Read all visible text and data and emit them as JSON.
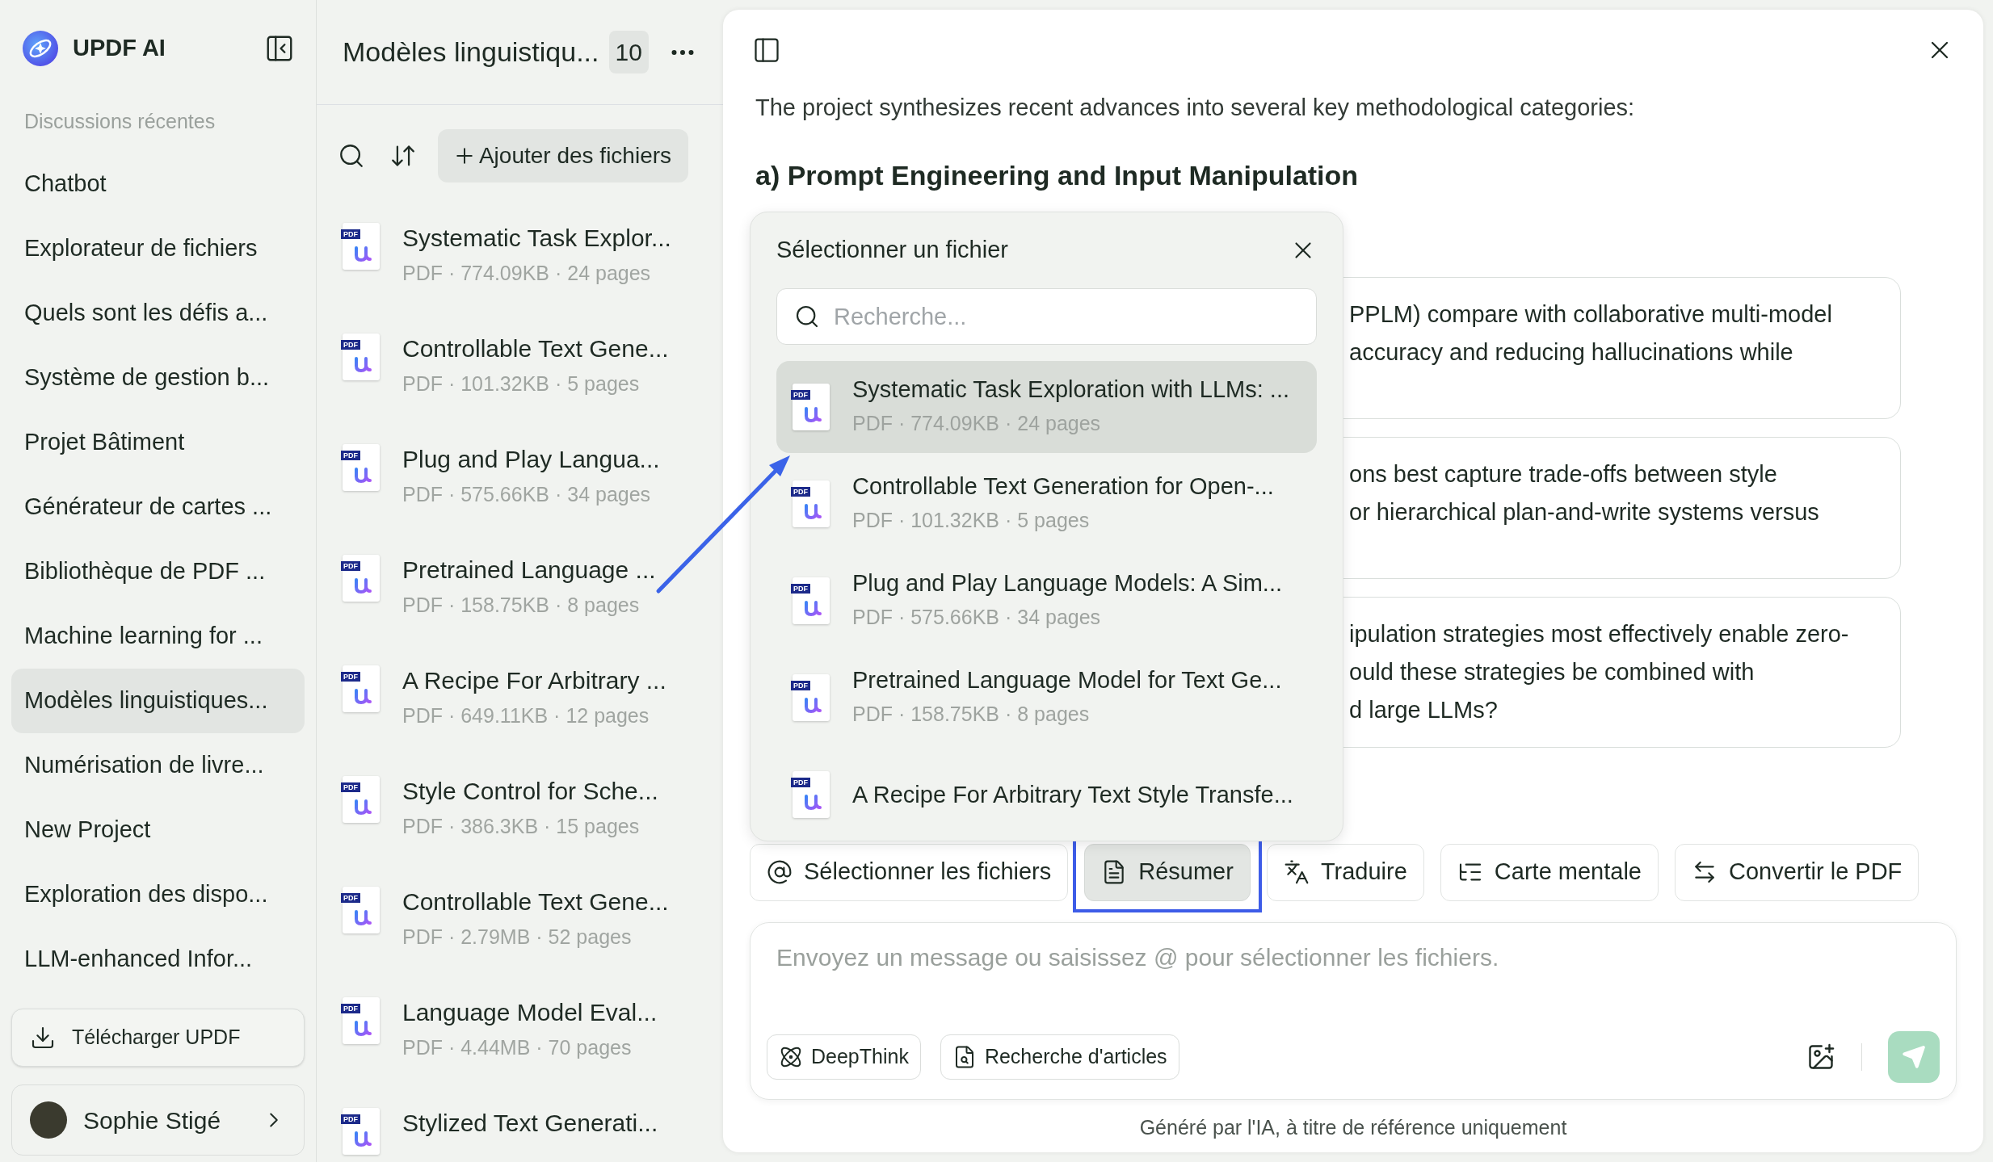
{
  "app": {
    "name": "UPDF AI"
  },
  "sidebar": {
    "section_label": "Discussions récentes",
    "items": [
      {
        "label": "Chatbot",
        "selected": false
      },
      {
        "label": "Explorateur de fichiers",
        "selected": false
      },
      {
        "label": "Quels sont les défis a...",
        "selected": false
      },
      {
        "label": "Système de gestion b...",
        "selected": false
      },
      {
        "label": "Projet Bâtiment",
        "selected": false
      },
      {
        "label": "Générateur de cartes ...",
        "selected": false
      },
      {
        "label": "Bibliothèque de PDF ...",
        "selected": false
      },
      {
        "label": "Machine learning for ...",
        "selected": false
      },
      {
        "label": "Modèles linguistiques...",
        "selected": true
      },
      {
        "label": "Numérisation de livre...",
        "selected": false
      },
      {
        "label": "New Project",
        "selected": false
      },
      {
        "label": "Exploration des dispo...",
        "selected": false
      },
      {
        "label": "LLM-enhanced Infor...",
        "selected": false
      }
    ],
    "download_button": "Télécharger UPDF",
    "user": {
      "name": "Sophie Stigé"
    }
  },
  "project": {
    "title": "Modèles linguistiqu...",
    "count": "10",
    "add_button": "Ajouter des fichiers",
    "files": [
      {
        "icon_label": "PDF",
        "title": "Systematic Task Explor...",
        "meta": "PDF · 774.09KB · 24 pages"
      },
      {
        "icon_label": "PDF",
        "title": "Controllable Text Gene...",
        "meta": "PDF · 101.32KB · 5 pages"
      },
      {
        "icon_label": "PDF",
        "title": "Plug and Play Langua...",
        "meta": "PDF · 575.66KB · 34 pages"
      },
      {
        "icon_label": "PDF",
        "title": "Pretrained Language ...",
        "meta": "PDF · 158.75KB · 8 pages"
      },
      {
        "icon_label": "PDF",
        "title": "A Recipe For Arbitrary ...",
        "meta": "PDF · 649.11KB · 12 pages"
      },
      {
        "icon_label": "PDF",
        "title": "Style Control for Sche...",
        "meta": "PDF · 386.3KB · 15 pages"
      },
      {
        "icon_label": "PDF",
        "title": "Controllable Text Gene...",
        "meta": "PDF · 2.79MB · 52 pages"
      },
      {
        "icon_label": "PDF",
        "title": "Language Model Eval...",
        "meta": "PDF · 4.44MB · 70 pages"
      },
      {
        "icon_label": "PDF",
        "title": "Stylized Text Generati..."
      }
    ]
  },
  "chat": {
    "intro": "The project synthesizes recent advances into several key methodological categories:",
    "heading": "a) Prompt Engineering and Input Manipulation",
    "cards": [
      {
        "lines": [
          "PPLM) compare with collaborative multi-model",
          "accuracy and reducing hallucinations while"
        ]
      },
      {
        "lines": [
          "ons best capture trade-offs between style",
          "or hierarchical plan-and-write systems versus"
        ]
      },
      {
        "lines": [
          "ipulation strategies most effectively enable zero-",
          "ould these strategies be combined with",
          "d large LLMs?"
        ]
      }
    ]
  },
  "file_picker": {
    "title": "Sélectionner un fichier",
    "search_placeholder": "Recherche...",
    "files": [
      {
        "icon_label": "PDF",
        "title": "Systematic Task Exploration with LLMs: ...",
        "meta": "PDF · 774.09KB · 24 pages",
        "selected": true
      },
      {
        "icon_label": "PDF",
        "title": "Controllable Text Generation for Open-...",
        "meta": "PDF · 101.32KB · 5 pages",
        "selected": false
      },
      {
        "icon_label": "PDF",
        "title": "Plug and Play Language Models: A Sim...",
        "meta": "PDF · 575.66KB · 34 pages",
        "selected": false
      },
      {
        "icon_label": "PDF",
        "title": "Pretrained Language Model for Text Ge...",
        "meta": "PDF · 158.75KB · 8 pages",
        "selected": false
      },
      {
        "icon_label": "PDF",
        "title": "A Recipe For Arbitrary Text Style Transfe...",
        "selected": false
      }
    ]
  },
  "actions": [
    {
      "kind": "mention",
      "label": "Sélectionner les fichiers",
      "selected": false
    },
    {
      "kind": "summarize",
      "label": "Résumer",
      "selected": true
    },
    {
      "kind": "translate",
      "label": "Traduire",
      "selected": false
    },
    {
      "kind": "mindmap",
      "label": "Carte mentale",
      "selected": false
    },
    {
      "kind": "convert",
      "label": "Convertir le PDF",
      "selected": false
    }
  ],
  "composer": {
    "placeholder": "Envoyez un message ou saisissez @ pour sélectionner les fichiers.",
    "tools": [
      {
        "kind": "deepthink",
        "label": "DeepThink"
      },
      {
        "kind": "research",
        "label": "Recherche d'articles"
      }
    ]
  },
  "footer": "Généré par l'IA, à titre de référence uniquement"
}
